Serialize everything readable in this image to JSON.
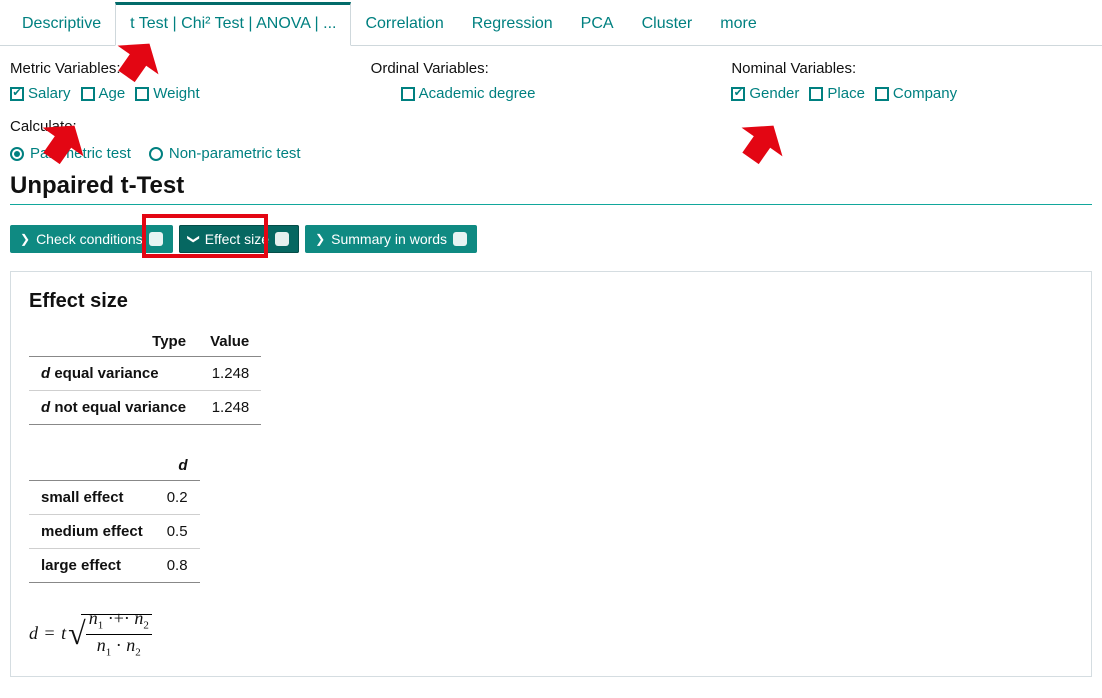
{
  "tabs": [
    {
      "label": "Descriptive"
    },
    {
      "label": "t Test | Chi² Test | ANOVA | ..."
    },
    {
      "label": "Correlation"
    },
    {
      "label": "Regression"
    },
    {
      "label": "PCA"
    },
    {
      "label": "Cluster"
    },
    {
      "label": "more"
    }
  ],
  "active_tab_index": 1,
  "vars": {
    "metric": {
      "title": "Metric Variables:",
      "items": [
        {
          "label": "Salary",
          "checked": true
        },
        {
          "label": "Age",
          "checked": false
        },
        {
          "label": "Weight",
          "checked": false
        }
      ]
    },
    "ordinal": {
      "title": "Ordinal Variables:",
      "items": [
        {
          "label": "Academic degree",
          "checked": false
        }
      ]
    },
    "nominal": {
      "title": "Nominal Variables:",
      "items": [
        {
          "label": "Gender",
          "checked": true
        },
        {
          "label": "Place",
          "checked": false
        },
        {
          "label": "Company",
          "checked": false
        }
      ]
    }
  },
  "calculate": {
    "title": "Calculate:",
    "options": [
      {
        "label": "Parametric test",
        "selected": true
      },
      {
        "label": "Non-parametric test",
        "selected": false
      }
    ]
  },
  "heading": "Unpaired t-Test",
  "pills": [
    {
      "label": "Check conditions",
      "icon": "check",
      "chev": "right",
      "active": false
    },
    {
      "label": "Effect size",
      "icon": "gauge",
      "chev": "down",
      "active": true
    },
    {
      "label": "Summary in words",
      "icon": "doc",
      "chev": "right",
      "active": false
    }
  ],
  "panel": {
    "title": "Effect size",
    "table1": {
      "headers": {
        "type": "Type",
        "value": "Value"
      },
      "rows": [
        {
          "type_prefix_d": true,
          "type": " equal variance",
          "value": "1.248"
        },
        {
          "type_prefix_d": true,
          "type": " not equal variance",
          "value": "1.248"
        }
      ]
    },
    "table2": {
      "header": "d",
      "rows": [
        {
          "label": "small effect",
          "value": "0.2"
        },
        {
          "label": "medium effect",
          "value": "0.5"
        },
        {
          "label": "large effect",
          "value": "0.8"
        }
      ]
    }
  }
}
